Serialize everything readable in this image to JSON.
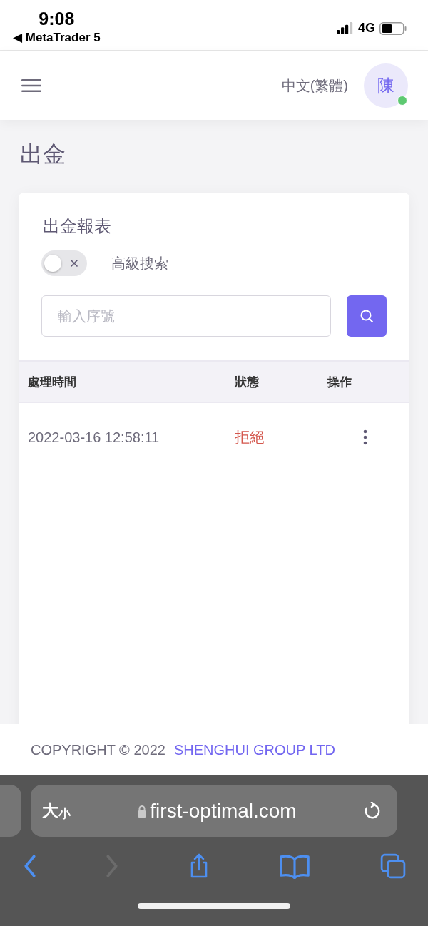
{
  "status_bar": {
    "time": "9:08",
    "back_app": "◀ MetaTrader 5",
    "network": "4G"
  },
  "header": {
    "language": "中文(繁體)",
    "avatar": {
      "initial": "陳",
      "online": true
    }
  },
  "page_title": "出金",
  "card": {
    "title": "出金報表",
    "advanced_search": {
      "label": "高級搜索",
      "on": false
    },
    "search": {
      "placeholder": "輸入序號"
    },
    "table": {
      "columns": [
        "處理時間",
        "狀態",
        "操作"
      ],
      "rows": [
        {
          "time": "2022-03-16 12:58:11",
          "status": {
            "text": "拒絕",
            "color": "#d4574d"
          }
        }
      ]
    }
  },
  "footer": {
    "copyright": "COPYRIGHT © 2022",
    "company": "SHENGHUI GROUP LTD"
  },
  "browser": {
    "text_size": "大小",
    "url": "first-optimal.com",
    "toolbar": [
      {
        "kind": "back",
        "disabled": false
      },
      {
        "kind": "forward",
        "disabled": true
      },
      {
        "kind": "share",
        "disabled": false
      },
      {
        "kind": "bookmarks",
        "disabled": false
      },
      {
        "kind": "tabs",
        "disabled": false
      }
    ]
  }
}
